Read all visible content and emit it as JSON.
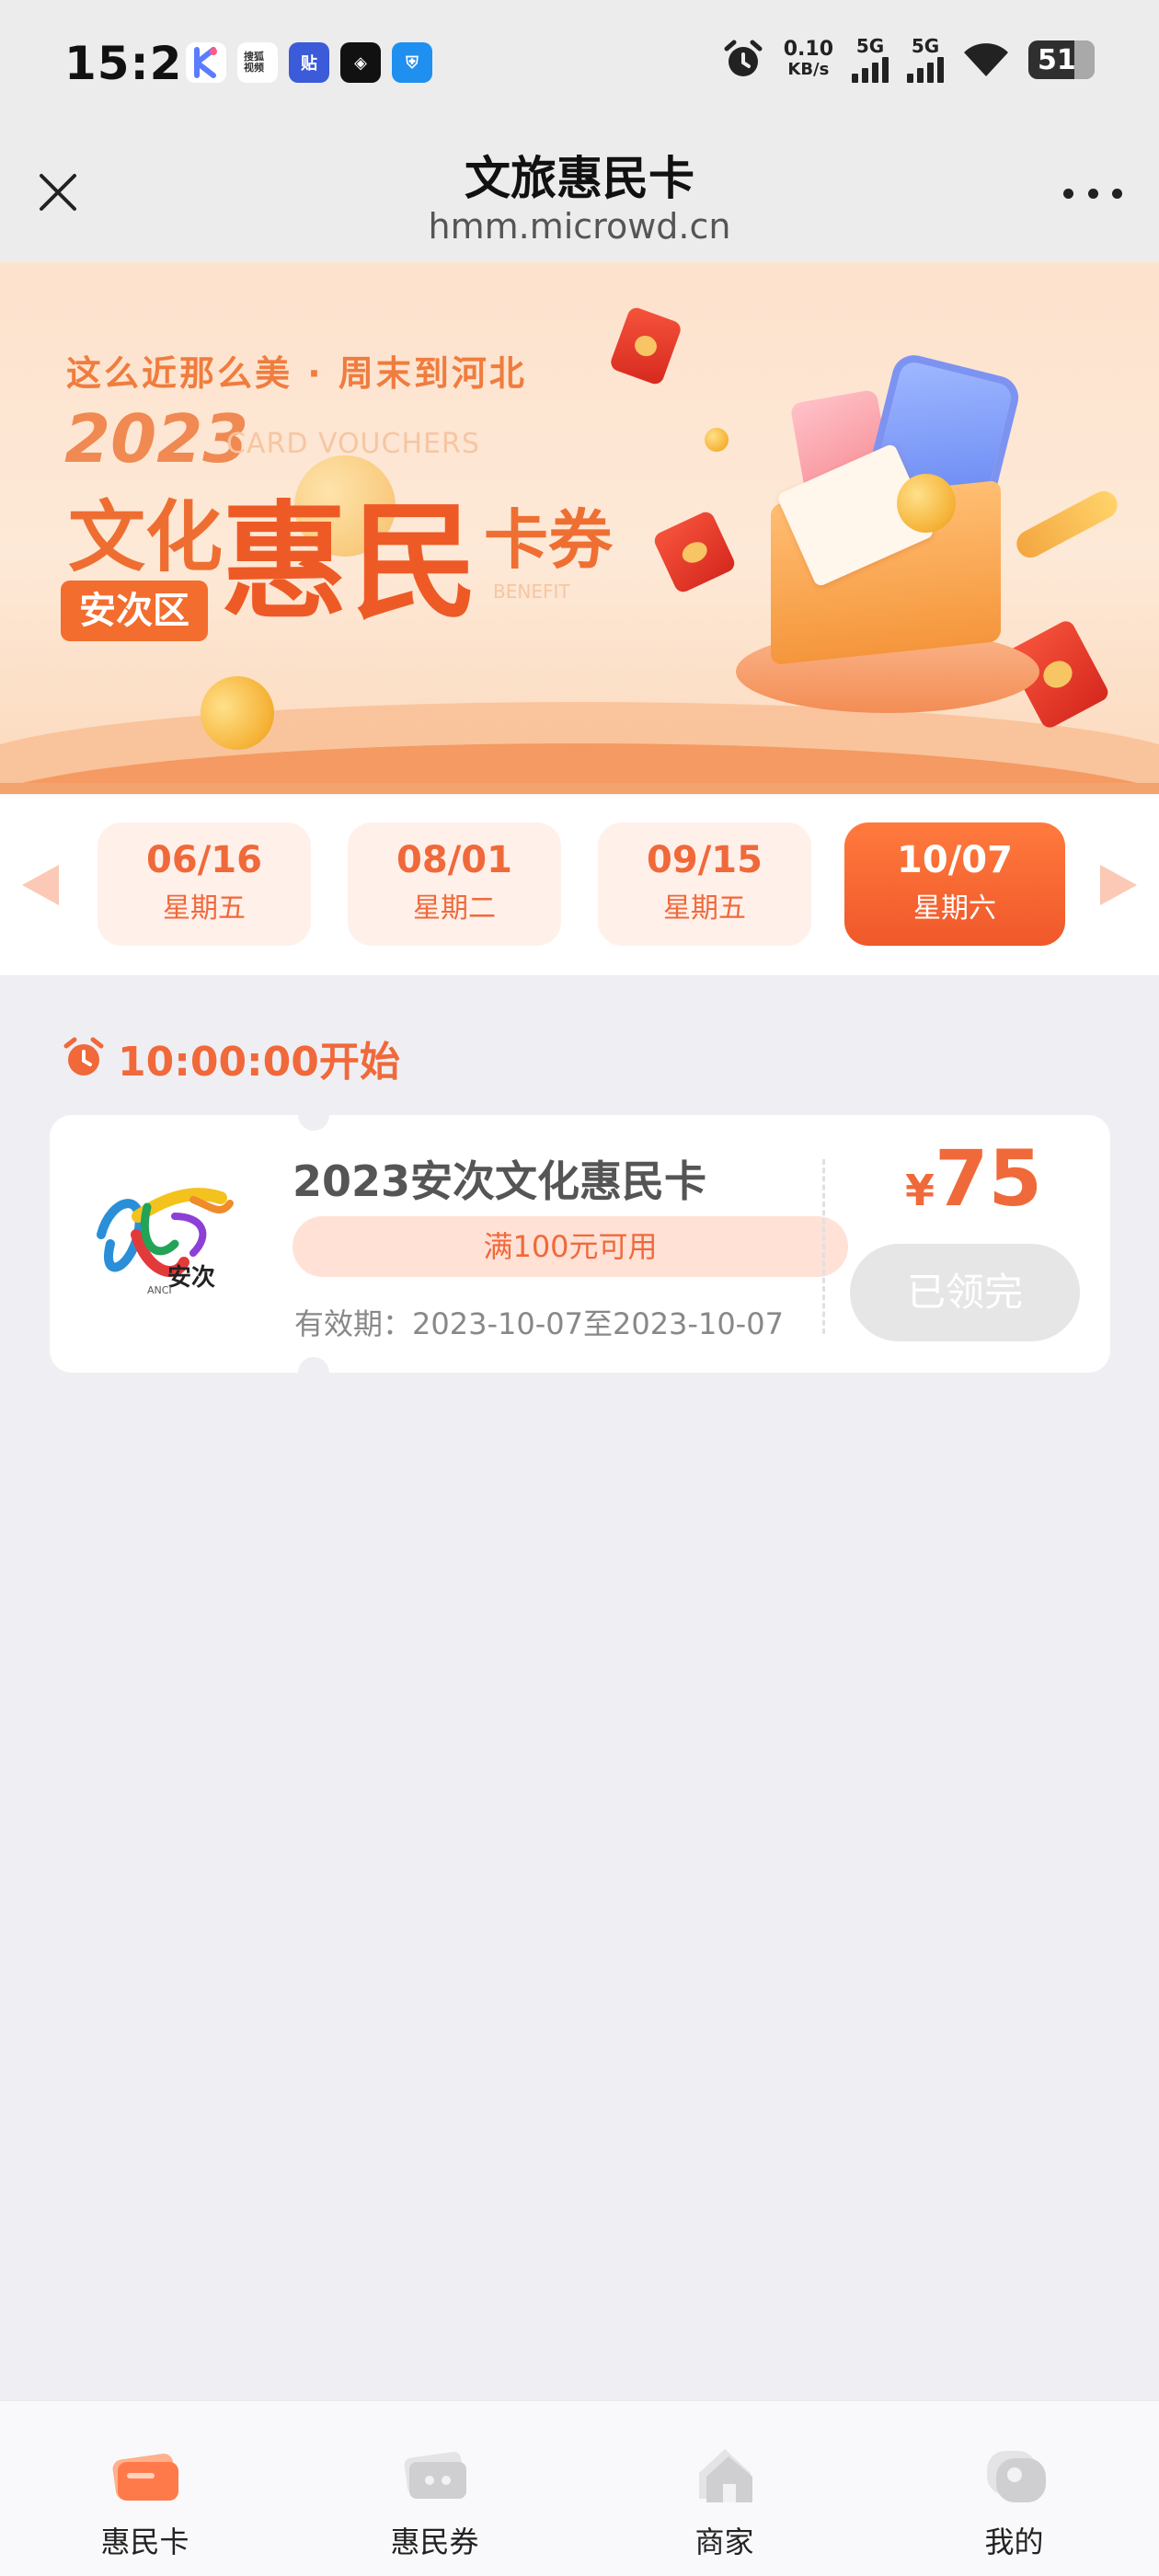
{
  "status_bar": {
    "time": "15:21",
    "net_speed_value": "0.10",
    "net_speed_unit": "KB/s",
    "sim1_label": "5G",
    "sim2_label": "5G",
    "battery": "51",
    "app_icons": [
      "k-app-icon",
      "souhu-video-icon",
      "tieba-icon",
      "app-cube-icon",
      "security-shield-icon"
    ],
    "app_icon_texts": [
      "K",
      "搜狐视频",
      "贴",
      "◈",
      "⛨"
    ]
  },
  "header": {
    "title": "文旅惠民卡",
    "url": "hmm.microwd.cn"
  },
  "banner": {
    "slogan": "这么近那么美 · 周末到河北",
    "year": "2023",
    "subtitle_en": "CARD VOUCHERS",
    "title_part1": "文化",
    "title_part2": "惠民",
    "title_part3": "卡券",
    "benefit_en": "BENEFIT",
    "district": "安次区"
  },
  "dates": [
    {
      "date": "06/16",
      "weekday": "星期五",
      "active": false
    },
    {
      "date": "08/01",
      "weekday": "星期二",
      "active": false
    },
    {
      "date": "09/15",
      "weekday": "星期五",
      "active": false
    },
    {
      "date": "10/07",
      "weekday": "星期六",
      "active": true
    }
  ],
  "session": {
    "start_time": "10:00:00开始"
  },
  "voucher": {
    "name": "2023安次文化惠民卡",
    "condition": "满100元可用",
    "validity": "有效期：2023-10-07至2023-10-07",
    "currency": "¥",
    "amount": "75",
    "button_label": "已领完",
    "logo_text": "安次",
    "logo_subtext": "ANCI"
  },
  "bottom_nav": [
    {
      "label": "惠民卡",
      "icon": "card-icon",
      "active": true
    },
    {
      "label": "惠民券",
      "icon": "ticket-icon",
      "active": false
    },
    {
      "label": "商家",
      "icon": "shop-icon",
      "active": false
    },
    {
      "label": "我的",
      "icon": "profile-icon",
      "active": false
    }
  ],
  "colors": {
    "accent": "#f0693a",
    "accent_dark": "#ee5a26",
    "disabled_button": "#e6e6e6",
    "background": "#efeff3"
  }
}
